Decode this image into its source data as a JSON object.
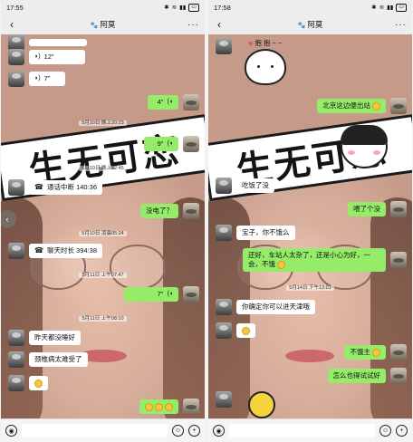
{
  "left": {
    "status": {
      "time": "17:55",
      "battery": ""
    },
    "title": "阿莫",
    "banner": "生无可恋",
    "messages": {
      "m1": "12\"",
      "m2": "7\"",
      "m3": "4\"",
      "ts1": "5月10日 晚上20:23",
      "m4": "9\"",
      "ts2": "5月10日 晚上22:45",
      "m5": "通话中断 140:36",
      "m6": "没电了？",
      "ts3": "5月10日 凌晨05:24",
      "m7": "聊天时长 394:38",
      "ts4": "5月11日 上午07:47",
      "m8": "7\"",
      "ts5": "5月11日 上午08:10",
      "m9": "昨天都没睡好",
      "m10": "颈椎病太难受了"
    }
  },
  "right": {
    "status": {
      "time": "17:58",
      "battery": ""
    },
    "title": "阿莫",
    "banner": "生无可恋",
    "hug": "抱 抱 ~ ~",
    "messages": {
      "m1": "北京这边便出站",
      "m2": "吃饭了没",
      "m3": "喂了个没",
      "m4": "宝子，你不饿么",
      "m5": "还好，车站人太杂了，还是小心为好，一会，不饿",
      "ts1": "5月14日 下午13:01",
      "m6": "你确定你可以进天津哦",
      "m7": "不饿主",
      "m8": "怎么也得试试好"
    }
  },
  "icons": {
    "back": "‹",
    "more": "···",
    "voice": "◉",
    "emoji": "☺",
    "plus": "+"
  }
}
